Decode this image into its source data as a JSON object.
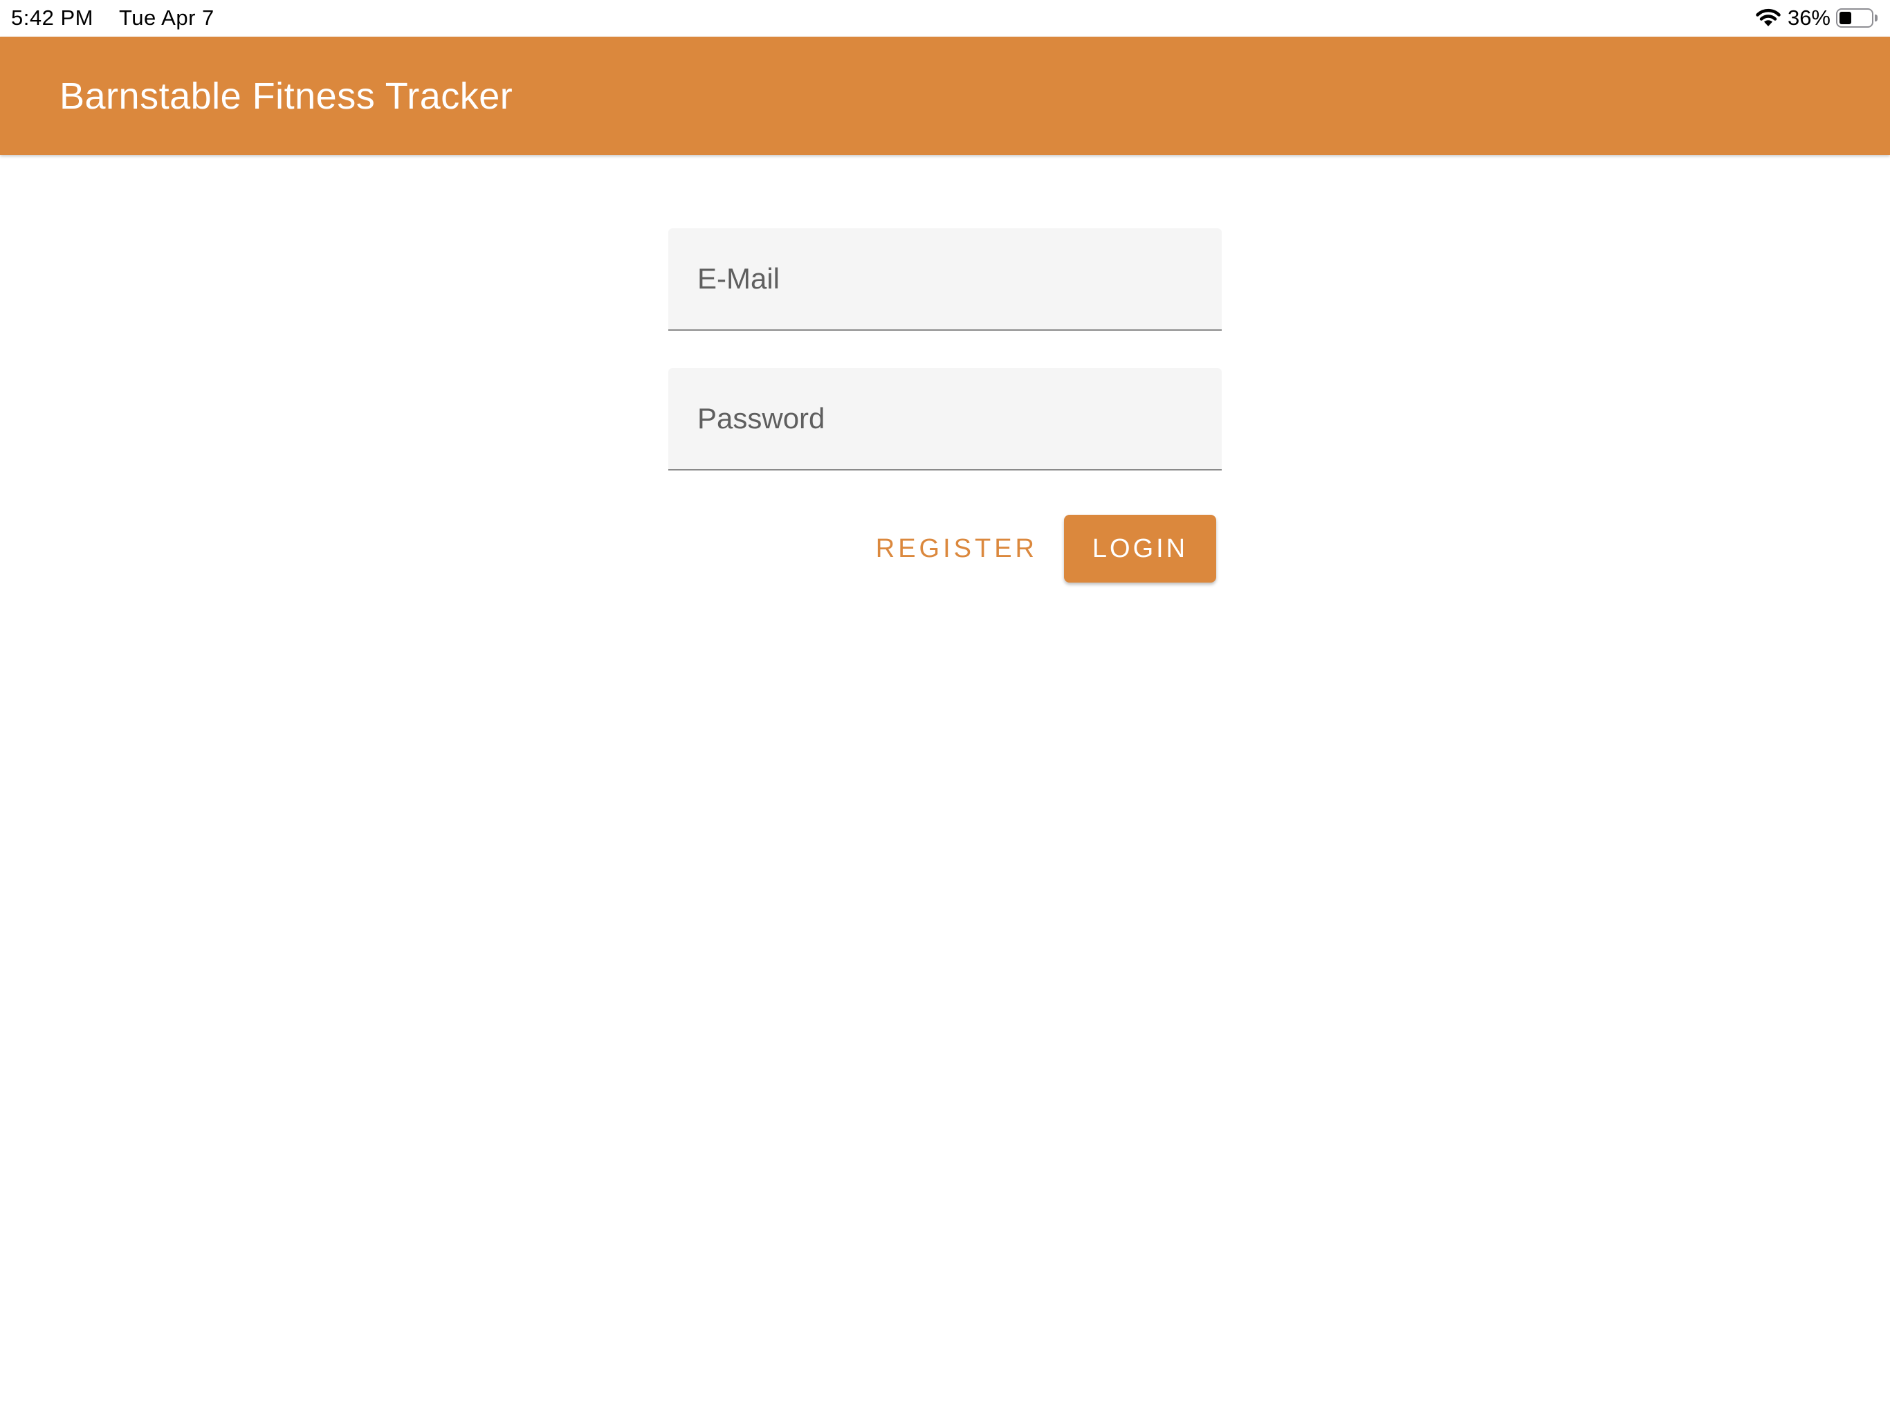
{
  "status_bar": {
    "time": "5:42 PM",
    "date": "Tue Apr 7",
    "battery_percent_label": "36%",
    "battery_level": 0.36,
    "wifi_icon": "wifi-icon",
    "battery_icon": "battery-icon"
  },
  "colors": {
    "accent": "#DB883D",
    "field_background": "#F5F5F5"
  },
  "app_bar": {
    "title": "Barnstable Fitness Tracker"
  },
  "login_form": {
    "email_placeholder": "E-Mail",
    "email_value": "",
    "password_placeholder": "Password",
    "password_value": "",
    "register_label": "REGISTER",
    "login_label": "LOGIN"
  }
}
